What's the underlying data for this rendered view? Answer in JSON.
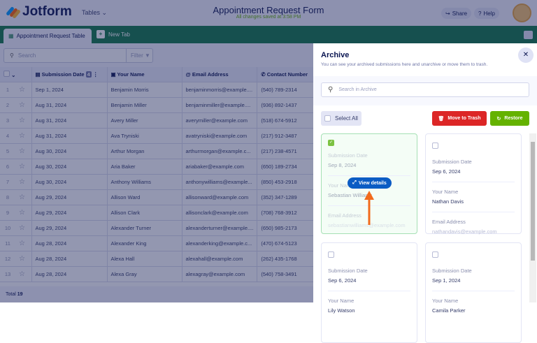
{
  "header": {
    "brand": "Jotform",
    "tables_label": "Tables",
    "title": "Appointment Request Form",
    "saved_status": "All changes saved at 3:58 PM",
    "share": "Share",
    "help": "Help"
  },
  "tabs": {
    "active": "Appointment Request Table",
    "new_tab": "New Tab"
  },
  "toolbar": {
    "search_placeholder": "Search",
    "filter": "Filter"
  },
  "table": {
    "columns": [
      "Submission Date",
      "Your Name",
      "Email Address",
      "Contact Number"
    ],
    "date_badge": "4",
    "rows": [
      [
        "1",
        "Sep 1, 2024",
        "Benjamin Morris",
        "benjaminmorris@example....",
        "(540) 789-2314"
      ],
      [
        "2",
        "Aug 31, 2024",
        "Benjamin Miller",
        "benjaminmiller@example....",
        "(936) 892-1437"
      ],
      [
        "3",
        "Aug 31, 2024",
        "Avery Miller",
        "averymiller@example.com",
        "(518) 674-5912"
      ],
      [
        "4",
        "Aug 31, 2024",
        "Ava Tryniski",
        "avatryniski@example.com",
        "(217) 912-3487"
      ],
      [
        "5",
        "Aug 30, 2024",
        "Arthur Morgan",
        "arthurmorgan@example.c...",
        "(217) 238-4571"
      ],
      [
        "6",
        "Aug 30, 2024",
        "Aria Baker",
        "ariabaker@example.com",
        "(650) 189-2734"
      ],
      [
        "7",
        "Aug 30, 2024",
        "Anthony Williams",
        "anthonywilliams@example...",
        "(850) 453-2918"
      ],
      [
        "8",
        "Aug 29, 2024",
        "Allison Ward",
        "allisonward@example.com",
        "(352) 347-1289"
      ],
      [
        "9",
        "Aug 29, 2024",
        "Allison Clark",
        "allisonclark@example.com",
        "(708) 768-3912"
      ],
      [
        "10",
        "Aug 29, 2024",
        "Alexander Turner",
        "alexanderturner@example....",
        "(650) 985-2173"
      ],
      [
        "11",
        "Aug 28, 2024",
        "Alexander King",
        "alexanderking@example.c...",
        "(470) 674-5123"
      ],
      [
        "12",
        "Aug 28, 2024",
        "Alexa Hall",
        "alexahall@example.com",
        "(262) 435-1768"
      ],
      [
        "13",
        "Aug 28, 2024",
        "Alexa Gray",
        "alexagray@example.com",
        "(540) 758-3491"
      ]
    ],
    "total_label": "Total",
    "total": "19"
  },
  "archive": {
    "title": "Archive",
    "subtitle": "You can see your archived submissions here and unarchive or move them to trash.",
    "search_placeholder": "Search in Archive",
    "select_all": "Select All",
    "move_to_trash": "Move to Trash",
    "restore": "Restore",
    "view_details": "View details",
    "cards": [
      {
        "date_label": "Submission Date",
        "date": "Sep 8, 2024",
        "name_label": "Your Name",
        "name": "Sebastian Williams",
        "email_label": "Email Address",
        "email": "sebastianwilliams@example.com",
        "checked": true
      },
      {
        "date_label": "Submission Date",
        "date": "Sep 6, 2024",
        "name_label": "Your Name",
        "name": "Nathan Davis",
        "email_label": "Email Address",
        "email": "nathandavis@example.com",
        "checked": false
      },
      {
        "date_label": "Submission Date",
        "date": "Sep 6, 2024",
        "name_label": "Your Name",
        "name": "Lily Watson",
        "checked": false
      },
      {
        "date_label": "Submission Date",
        "date": "Sep 1, 2024",
        "name_label": "Your Name",
        "name": "Camila Parker",
        "checked": false
      }
    ]
  },
  "colors": {
    "brand_green": "#117846",
    "trash": "#dc2626",
    "restore": "#64b200",
    "view_details": "#0b5cc4",
    "arrow": "#f26a1b"
  }
}
